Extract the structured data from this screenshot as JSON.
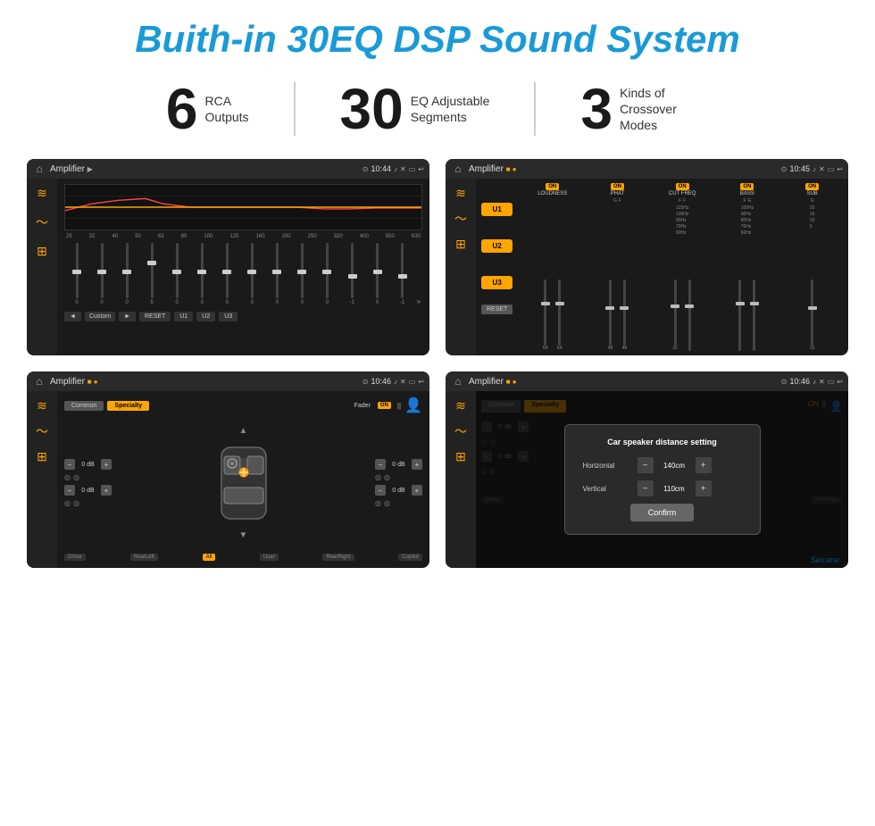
{
  "page": {
    "title": "Buith-in 30EQ DSP Sound System",
    "background": "#ffffff"
  },
  "stats": [
    {
      "number": "6",
      "label_line1": "RCA",
      "label_line2": "Outputs"
    },
    {
      "number": "30",
      "label_line1": "EQ Adjustable",
      "label_line2": "Segments"
    },
    {
      "number": "3",
      "label_line1": "Kinds of",
      "label_line2": "Crossover Modes"
    }
  ],
  "screen1": {
    "topbar": {
      "title": "Amplifier",
      "time": "10:44"
    },
    "eq_freqs": [
      "25",
      "32",
      "40",
      "50",
      "63",
      "80",
      "100",
      "125",
      "160",
      "200",
      "250",
      "320",
      "400",
      "500",
      "630"
    ],
    "eq_values": [
      "0",
      "0",
      "0",
      "5",
      "0",
      "0",
      "0",
      "0",
      "0",
      "0",
      "0",
      "-1",
      "0",
      "-1"
    ],
    "bottom_btns": [
      "Custom",
      "RESET",
      "U1",
      "U2",
      "U3"
    ]
  },
  "screen2": {
    "topbar": {
      "title": "Amplifier",
      "time": "10:45"
    },
    "ux_buttons": [
      "U1",
      "U2",
      "U3"
    ],
    "sections": [
      "LOUDNESS",
      "PHAT",
      "CUT FREQ",
      "BASS",
      "SUB"
    ],
    "reset_label": "RESET"
  },
  "screen3": {
    "topbar": {
      "title": "Amplifier",
      "time": "10:46"
    },
    "tabs": [
      "Common",
      "Specialty"
    ],
    "fader_label": "Fader",
    "on_label": "ON",
    "db_values": [
      "0 dB",
      "0 dB",
      "0 dB",
      "0 dB"
    ],
    "position_labels": [
      "Driver",
      "RearLeft",
      "All",
      "User",
      "RearRight",
      "Copilot"
    ]
  },
  "screen4": {
    "topbar": {
      "title": "Amplifier",
      "time": "10:46"
    },
    "tabs": [
      "Common",
      "Specialty"
    ],
    "dialog": {
      "title": "Car speaker distance setting",
      "horizontal_label": "Horizontal",
      "horizontal_value": "140cm",
      "vertical_label": "Vertical",
      "vertical_value": "110cm",
      "confirm_label": "Confirm"
    },
    "db_values": [
      "0 dB",
      "0 dB"
    ],
    "position_labels": [
      "Driver",
      "RearLeft",
      "Copilot",
      "RearRight"
    ]
  },
  "watermark": "Seicane",
  "icons": {
    "home": "⌂",
    "eq": "≋",
    "wave": "〜",
    "crossover": "⊞",
    "chevron_left": "◄",
    "chevron_right": "►",
    "chevron_up": "▲",
    "chevron_down": "▼",
    "minus": "−",
    "plus": "+",
    "location": "⊙",
    "volume": "♪",
    "camera": "⊡",
    "close": "✕",
    "screen": "▭",
    "back": "↩",
    "settings": "☰",
    "user": "👤",
    "speaker": "◎"
  }
}
